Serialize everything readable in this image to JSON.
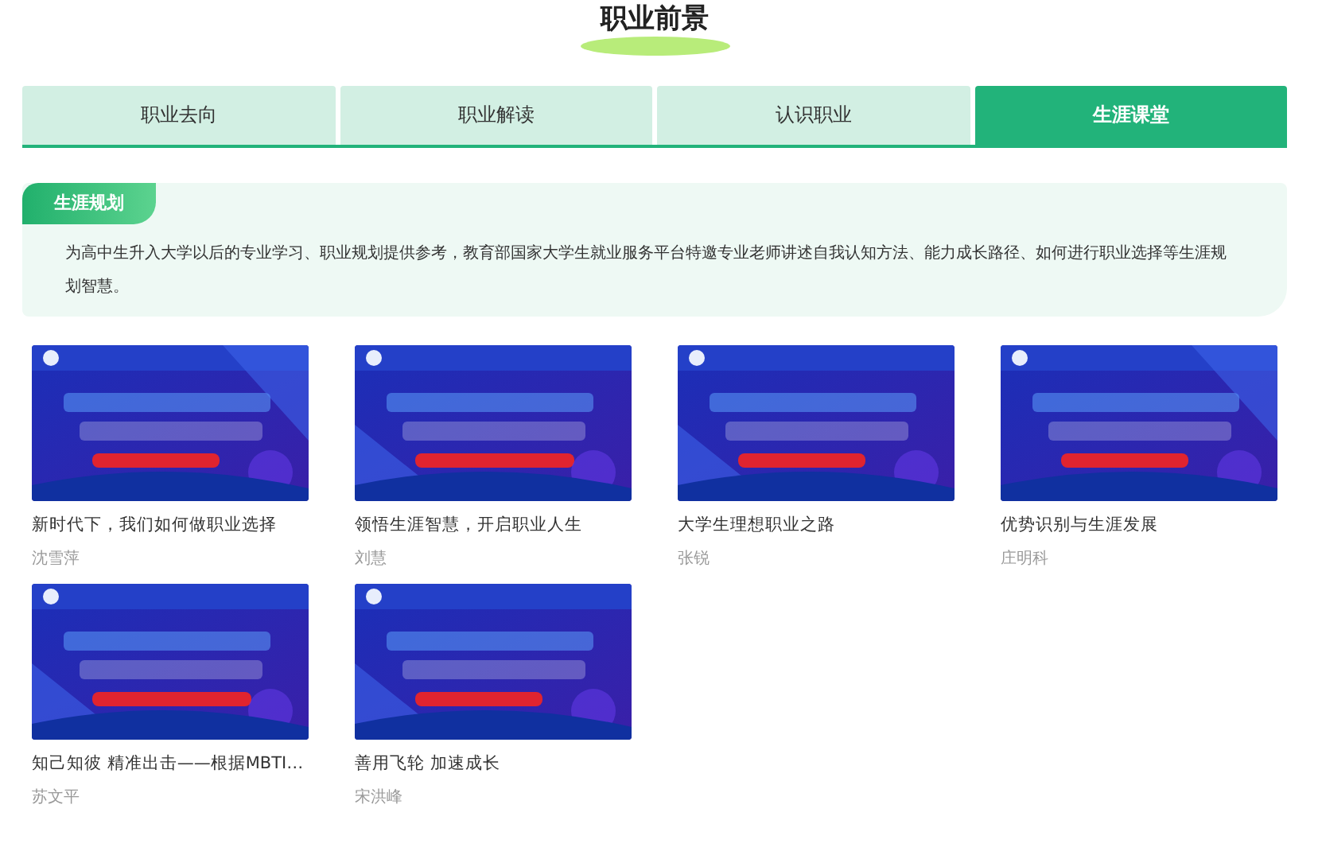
{
  "page_title": "职业前景",
  "tabs": [
    {
      "label": "职业去向",
      "selected": false
    },
    {
      "label": "职业解读",
      "selected": false
    },
    {
      "label": "认识职业",
      "selected": false
    },
    {
      "label": "生涯课堂",
      "selected": true
    }
  ],
  "section": {
    "tag": "生涯规划",
    "description": "为高中生升入大学以后的专业学习、职业规划提供参考，教育部国家大学生就业服务平台特邀专业老师讲述自我认知方法、能力成长路径、如何进行职业选择等生涯规划智慧。"
  },
  "courses": [
    {
      "kind": "picture",
      "title": "新时代下，我们如何做职业选择",
      "author": "沈雪萍"
    },
    {
      "kind": "picture",
      "title": "领悟生涯智慧，开启职业人生",
      "author": "刘慧"
    },
    {
      "kind": "picture",
      "title": "大学生理想职业之路",
      "author": "张锐"
    },
    {
      "kind": "picture",
      "title": "优势识别与生涯发展",
      "author": "庄明科"
    },
    {
      "kind": "picture",
      "title": "知己知彼 精准出击——根据MBTI…",
      "author": "苏文平"
    },
    {
      "kind": "picture",
      "title": "善用飞轮 加速成长",
      "author": "宋洪峰"
    }
  ]
}
